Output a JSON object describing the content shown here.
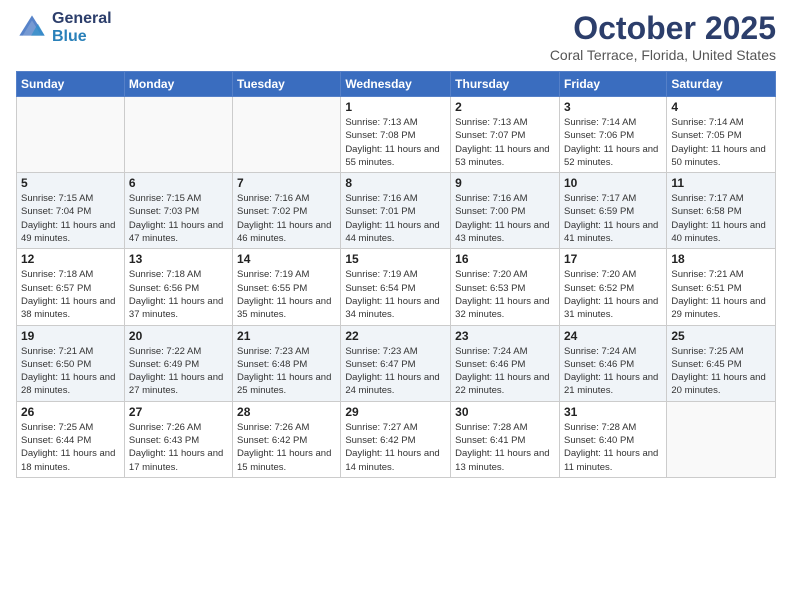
{
  "header": {
    "logo_line1": "General",
    "logo_line2": "Blue",
    "month": "October 2025",
    "location": "Coral Terrace, Florida, United States"
  },
  "weekdays": [
    "Sunday",
    "Monday",
    "Tuesday",
    "Wednesday",
    "Thursday",
    "Friday",
    "Saturday"
  ],
  "weeks": [
    [
      {
        "day": "",
        "sunrise": "",
        "sunset": "",
        "daylight": ""
      },
      {
        "day": "",
        "sunrise": "",
        "sunset": "",
        "daylight": ""
      },
      {
        "day": "",
        "sunrise": "",
        "sunset": "",
        "daylight": ""
      },
      {
        "day": "1",
        "sunrise": "Sunrise: 7:13 AM",
        "sunset": "Sunset: 7:08 PM",
        "daylight": "Daylight: 11 hours and 55 minutes."
      },
      {
        "day": "2",
        "sunrise": "Sunrise: 7:13 AM",
        "sunset": "Sunset: 7:07 PM",
        "daylight": "Daylight: 11 hours and 53 minutes."
      },
      {
        "day": "3",
        "sunrise": "Sunrise: 7:14 AM",
        "sunset": "Sunset: 7:06 PM",
        "daylight": "Daylight: 11 hours and 52 minutes."
      },
      {
        "day": "4",
        "sunrise": "Sunrise: 7:14 AM",
        "sunset": "Sunset: 7:05 PM",
        "daylight": "Daylight: 11 hours and 50 minutes."
      }
    ],
    [
      {
        "day": "5",
        "sunrise": "Sunrise: 7:15 AM",
        "sunset": "Sunset: 7:04 PM",
        "daylight": "Daylight: 11 hours and 49 minutes."
      },
      {
        "day": "6",
        "sunrise": "Sunrise: 7:15 AM",
        "sunset": "Sunset: 7:03 PM",
        "daylight": "Daylight: 11 hours and 47 minutes."
      },
      {
        "day": "7",
        "sunrise": "Sunrise: 7:16 AM",
        "sunset": "Sunset: 7:02 PM",
        "daylight": "Daylight: 11 hours and 46 minutes."
      },
      {
        "day": "8",
        "sunrise": "Sunrise: 7:16 AM",
        "sunset": "Sunset: 7:01 PM",
        "daylight": "Daylight: 11 hours and 44 minutes."
      },
      {
        "day": "9",
        "sunrise": "Sunrise: 7:16 AM",
        "sunset": "Sunset: 7:00 PM",
        "daylight": "Daylight: 11 hours and 43 minutes."
      },
      {
        "day": "10",
        "sunrise": "Sunrise: 7:17 AM",
        "sunset": "Sunset: 6:59 PM",
        "daylight": "Daylight: 11 hours and 41 minutes."
      },
      {
        "day": "11",
        "sunrise": "Sunrise: 7:17 AM",
        "sunset": "Sunset: 6:58 PM",
        "daylight": "Daylight: 11 hours and 40 minutes."
      }
    ],
    [
      {
        "day": "12",
        "sunrise": "Sunrise: 7:18 AM",
        "sunset": "Sunset: 6:57 PM",
        "daylight": "Daylight: 11 hours and 38 minutes."
      },
      {
        "day": "13",
        "sunrise": "Sunrise: 7:18 AM",
        "sunset": "Sunset: 6:56 PM",
        "daylight": "Daylight: 11 hours and 37 minutes."
      },
      {
        "day": "14",
        "sunrise": "Sunrise: 7:19 AM",
        "sunset": "Sunset: 6:55 PM",
        "daylight": "Daylight: 11 hours and 35 minutes."
      },
      {
        "day": "15",
        "sunrise": "Sunrise: 7:19 AM",
        "sunset": "Sunset: 6:54 PM",
        "daylight": "Daylight: 11 hours and 34 minutes."
      },
      {
        "day": "16",
        "sunrise": "Sunrise: 7:20 AM",
        "sunset": "Sunset: 6:53 PM",
        "daylight": "Daylight: 11 hours and 32 minutes."
      },
      {
        "day": "17",
        "sunrise": "Sunrise: 7:20 AM",
        "sunset": "Sunset: 6:52 PM",
        "daylight": "Daylight: 11 hours and 31 minutes."
      },
      {
        "day": "18",
        "sunrise": "Sunrise: 7:21 AM",
        "sunset": "Sunset: 6:51 PM",
        "daylight": "Daylight: 11 hours and 29 minutes."
      }
    ],
    [
      {
        "day": "19",
        "sunrise": "Sunrise: 7:21 AM",
        "sunset": "Sunset: 6:50 PM",
        "daylight": "Daylight: 11 hours and 28 minutes."
      },
      {
        "day": "20",
        "sunrise": "Sunrise: 7:22 AM",
        "sunset": "Sunset: 6:49 PM",
        "daylight": "Daylight: 11 hours and 27 minutes."
      },
      {
        "day": "21",
        "sunrise": "Sunrise: 7:23 AM",
        "sunset": "Sunset: 6:48 PM",
        "daylight": "Daylight: 11 hours and 25 minutes."
      },
      {
        "day": "22",
        "sunrise": "Sunrise: 7:23 AM",
        "sunset": "Sunset: 6:47 PM",
        "daylight": "Daylight: 11 hours and 24 minutes."
      },
      {
        "day": "23",
        "sunrise": "Sunrise: 7:24 AM",
        "sunset": "Sunset: 6:46 PM",
        "daylight": "Daylight: 11 hours and 22 minutes."
      },
      {
        "day": "24",
        "sunrise": "Sunrise: 7:24 AM",
        "sunset": "Sunset: 6:46 PM",
        "daylight": "Daylight: 11 hours and 21 minutes."
      },
      {
        "day": "25",
        "sunrise": "Sunrise: 7:25 AM",
        "sunset": "Sunset: 6:45 PM",
        "daylight": "Daylight: 11 hours and 20 minutes."
      }
    ],
    [
      {
        "day": "26",
        "sunrise": "Sunrise: 7:25 AM",
        "sunset": "Sunset: 6:44 PM",
        "daylight": "Daylight: 11 hours and 18 minutes."
      },
      {
        "day": "27",
        "sunrise": "Sunrise: 7:26 AM",
        "sunset": "Sunset: 6:43 PM",
        "daylight": "Daylight: 11 hours and 17 minutes."
      },
      {
        "day": "28",
        "sunrise": "Sunrise: 7:26 AM",
        "sunset": "Sunset: 6:42 PM",
        "daylight": "Daylight: 11 hours and 15 minutes."
      },
      {
        "day": "29",
        "sunrise": "Sunrise: 7:27 AM",
        "sunset": "Sunset: 6:42 PM",
        "daylight": "Daylight: 11 hours and 14 minutes."
      },
      {
        "day": "30",
        "sunrise": "Sunrise: 7:28 AM",
        "sunset": "Sunset: 6:41 PM",
        "daylight": "Daylight: 11 hours and 13 minutes."
      },
      {
        "day": "31",
        "sunrise": "Sunrise: 7:28 AM",
        "sunset": "Sunset: 6:40 PM",
        "daylight": "Daylight: 11 hours and 11 minutes."
      },
      {
        "day": "",
        "sunrise": "",
        "sunset": "",
        "daylight": ""
      }
    ]
  ]
}
